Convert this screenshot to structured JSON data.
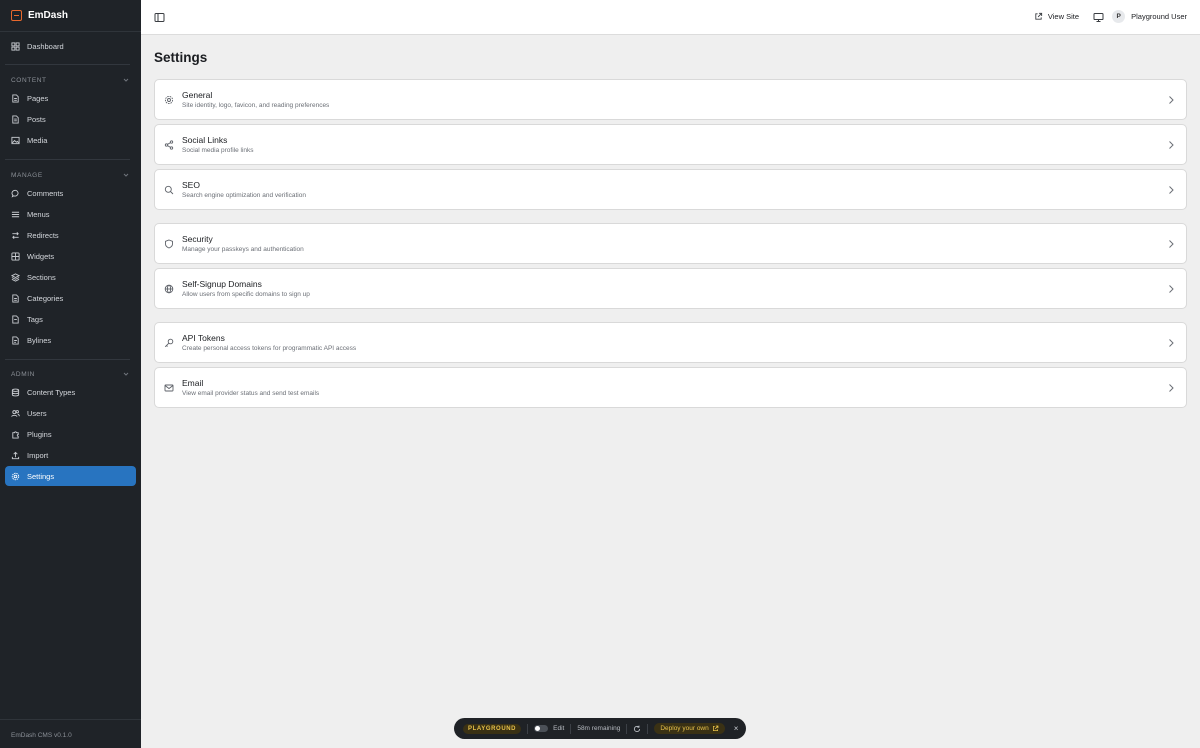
{
  "sidebar": {
    "brand": "EmDash",
    "dashboard": "Dashboard",
    "sections": [
      {
        "label": "Content",
        "items": [
          "Pages",
          "Posts",
          "Media"
        ]
      },
      {
        "label": "Manage",
        "items": [
          "Comments",
          "Menus",
          "Redirects",
          "Widgets",
          "Sections",
          "Categories",
          "Tags",
          "Bylines"
        ]
      },
      {
        "label": "Admin",
        "items": [
          "Content Types",
          "Users",
          "Plugins",
          "Import",
          "Settings"
        ]
      }
    ],
    "active_item": "Settings",
    "version": "EmDash CMS v0.1.0"
  },
  "topbar": {
    "view_site": "View Site",
    "user_initial": "P",
    "user_name": "Playground User"
  },
  "page": {
    "title": "Settings",
    "cards": [
      {
        "title": "General",
        "desc": "Site identity, logo, favicon, and reading preferences",
        "icon": "gear-icon"
      },
      {
        "title": "Social Links",
        "desc": "Social media profile links",
        "icon": "share-icon"
      },
      {
        "title": "SEO",
        "desc": "Search engine optimization and verification",
        "icon": "search-icon"
      },
      {
        "title": "Security",
        "desc": "Manage your passkeys and authentication",
        "icon": "shield-icon"
      },
      {
        "title": "Self-Signup Domains",
        "desc": "Allow users from specific domains to sign up",
        "icon": "globe-icon"
      },
      {
        "title": "API Tokens",
        "desc": "Create personal access tokens for programmatic API access",
        "icon": "key-icon"
      },
      {
        "title": "Email",
        "desc": "View email provider status and send test emails",
        "icon": "mail-icon"
      }
    ]
  },
  "playground": {
    "badge": "PLAYGROUND",
    "edit_label": "Edit",
    "remaining": "58m remaining",
    "deploy": "Deploy your own",
    "close": "×"
  },
  "colors": {
    "sidebar_bg": "#1f2328",
    "active_bg": "#2874c0",
    "brand_accent": "#e8682d",
    "playground_accent": "#e8c24a"
  }
}
